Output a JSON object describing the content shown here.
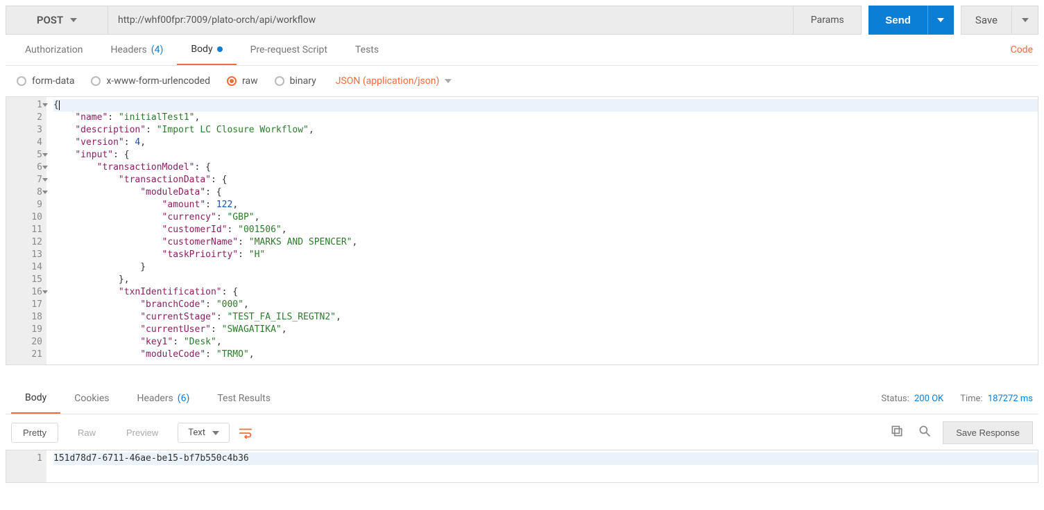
{
  "request": {
    "method": "POST",
    "url": "http://whf00fpr:7009/plato-orch/api/workflow",
    "params_label": "Params",
    "send_label": "Send",
    "save_label": "Save"
  },
  "tabs": {
    "authorization": "Authorization",
    "headers": "Headers",
    "headers_count": "(4)",
    "body": "Body",
    "prerequest": "Pre-request Script",
    "tests": "Tests",
    "code_link": "Code"
  },
  "body_opts": {
    "formdata": "form-data",
    "urlencoded": "x-www-form-urlencoded",
    "raw": "raw",
    "binary": "binary",
    "contenttype": "JSON (application/json)"
  },
  "editor_lines": [
    {
      "n": 1,
      "fold": true,
      "hl": true,
      "tokens": [
        {
          "t": "p",
          "v": "{"
        },
        {
          "t": "cur",
          "v": ""
        }
      ]
    },
    {
      "n": 2,
      "tokens": [
        {
          "t": "p",
          "v": "    "
        },
        {
          "t": "k",
          "v": "\"name\""
        },
        {
          "t": "p",
          "v": ": "
        },
        {
          "t": "s",
          "v": "\"initialTest1\""
        },
        {
          "t": "p",
          "v": ","
        }
      ]
    },
    {
      "n": 3,
      "tokens": [
        {
          "t": "p",
          "v": "    "
        },
        {
          "t": "k",
          "v": "\"description\""
        },
        {
          "t": "p",
          "v": ": "
        },
        {
          "t": "s",
          "v": "\"Import LC Closure Workflow\""
        },
        {
          "t": "p",
          "v": ","
        }
      ]
    },
    {
      "n": 4,
      "tokens": [
        {
          "t": "p",
          "v": "    "
        },
        {
          "t": "k",
          "v": "\"version\""
        },
        {
          "t": "p",
          "v": ": "
        },
        {
          "t": "n",
          "v": "4"
        },
        {
          "t": "p",
          "v": ","
        }
      ]
    },
    {
      "n": 5,
      "fold": true,
      "tokens": [
        {
          "t": "p",
          "v": "    "
        },
        {
          "t": "k",
          "v": "\"input\""
        },
        {
          "t": "p",
          "v": ": {"
        }
      ]
    },
    {
      "n": 6,
      "fold": true,
      "tokens": [
        {
          "t": "p",
          "v": "        "
        },
        {
          "t": "k",
          "v": "\"transactionModel\""
        },
        {
          "t": "p",
          "v": ": {"
        }
      ]
    },
    {
      "n": 7,
      "fold": true,
      "tokens": [
        {
          "t": "p",
          "v": "            "
        },
        {
          "t": "k",
          "v": "\"transactionData\""
        },
        {
          "t": "p",
          "v": ": {"
        }
      ]
    },
    {
      "n": 8,
      "fold": true,
      "tokens": [
        {
          "t": "p",
          "v": "                "
        },
        {
          "t": "k",
          "v": "\"moduleData\""
        },
        {
          "t": "p",
          "v": ": {"
        }
      ]
    },
    {
      "n": 9,
      "tokens": [
        {
          "t": "p",
          "v": "                    "
        },
        {
          "t": "k",
          "v": "\"amount\""
        },
        {
          "t": "p",
          "v": ": "
        },
        {
          "t": "n",
          "v": "122"
        },
        {
          "t": "p",
          "v": ","
        }
      ]
    },
    {
      "n": 10,
      "tokens": [
        {
          "t": "p",
          "v": "                    "
        },
        {
          "t": "k",
          "v": "\"currency\""
        },
        {
          "t": "p",
          "v": ": "
        },
        {
          "t": "s",
          "v": "\"GBP\""
        },
        {
          "t": "p",
          "v": ","
        }
      ]
    },
    {
      "n": 11,
      "tokens": [
        {
          "t": "p",
          "v": "                    "
        },
        {
          "t": "k",
          "v": "\"customerId\""
        },
        {
          "t": "p",
          "v": ": "
        },
        {
          "t": "s",
          "v": "\"001506\""
        },
        {
          "t": "p",
          "v": ","
        }
      ]
    },
    {
      "n": 12,
      "tokens": [
        {
          "t": "p",
          "v": "                    "
        },
        {
          "t": "k",
          "v": "\"customerName\""
        },
        {
          "t": "p",
          "v": ": "
        },
        {
          "t": "s",
          "v": "\"MARKS AND SPENCER\""
        },
        {
          "t": "p",
          "v": ","
        }
      ]
    },
    {
      "n": 13,
      "tokens": [
        {
          "t": "p",
          "v": "                    "
        },
        {
          "t": "k",
          "v": "\"taskPrioirty\""
        },
        {
          "t": "p",
          "v": ": "
        },
        {
          "t": "s",
          "v": "\"H\""
        }
      ]
    },
    {
      "n": 14,
      "tokens": [
        {
          "t": "p",
          "v": "                }"
        }
      ]
    },
    {
      "n": 15,
      "tokens": [
        {
          "t": "p",
          "v": "            },"
        }
      ]
    },
    {
      "n": 16,
      "fold": true,
      "tokens": [
        {
          "t": "p",
          "v": "            "
        },
        {
          "t": "k",
          "v": "\"txnIdentification\""
        },
        {
          "t": "p",
          "v": ": {"
        }
      ]
    },
    {
      "n": 17,
      "tokens": [
        {
          "t": "p",
          "v": "                "
        },
        {
          "t": "k",
          "v": "\"branchCode\""
        },
        {
          "t": "p",
          "v": ": "
        },
        {
          "t": "s",
          "v": "\"000\""
        },
        {
          "t": "p",
          "v": ","
        }
      ]
    },
    {
      "n": 18,
      "tokens": [
        {
          "t": "p",
          "v": "                "
        },
        {
          "t": "k",
          "v": "\"currentStage\""
        },
        {
          "t": "p",
          "v": ": "
        },
        {
          "t": "s",
          "v": "\"TEST_FA_ILS_REGTN2\""
        },
        {
          "t": "p",
          "v": ","
        }
      ]
    },
    {
      "n": 19,
      "tokens": [
        {
          "t": "p",
          "v": "                "
        },
        {
          "t": "k",
          "v": "\"currentUser\""
        },
        {
          "t": "p",
          "v": ": "
        },
        {
          "t": "s",
          "v": "\"SWAGATIKA\""
        },
        {
          "t": "p",
          "v": ","
        }
      ]
    },
    {
      "n": 20,
      "tokens": [
        {
          "t": "p",
          "v": "                "
        },
        {
          "t": "k",
          "v": "\"key1\""
        },
        {
          "t": "p",
          "v": ": "
        },
        {
          "t": "s",
          "v": "\"Desk\""
        },
        {
          "t": "p",
          "v": ","
        }
      ]
    },
    {
      "n": 21,
      "tokens": [
        {
          "t": "p",
          "v": "                "
        },
        {
          "t": "k",
          "v": "\"moduleCode\""
        },
        {
          "t": "p",
          "v": ": "
        },
        {
          "t": "s",
          "v": "\"TRMO\""
        },
        {
          "t": "p",
          "v": ","
        }
      ]
    }
  ],
  "response": {
    "tabs": {
      "body": "Body",
      "cookies": "Cookies",
      "headers": "Headers",
      "headers_count": "(6)",
      "testresults": "Test Results"
    },
    "status_label": "Status:",
    "status_value": "200 OK",
    "time_label": "Time:",
    "time_value": "187272 ms",
    "toolbar": {
      "pretty": "Pretty",
      "raw": "Raw",
      "preview": "Preview",
      "fmt": "Text",
      "saveresp": "Save Response"
    },
    "body_line": "151d78d7-6711-46ae-be15-bf7b550c4b36"
  }
}
